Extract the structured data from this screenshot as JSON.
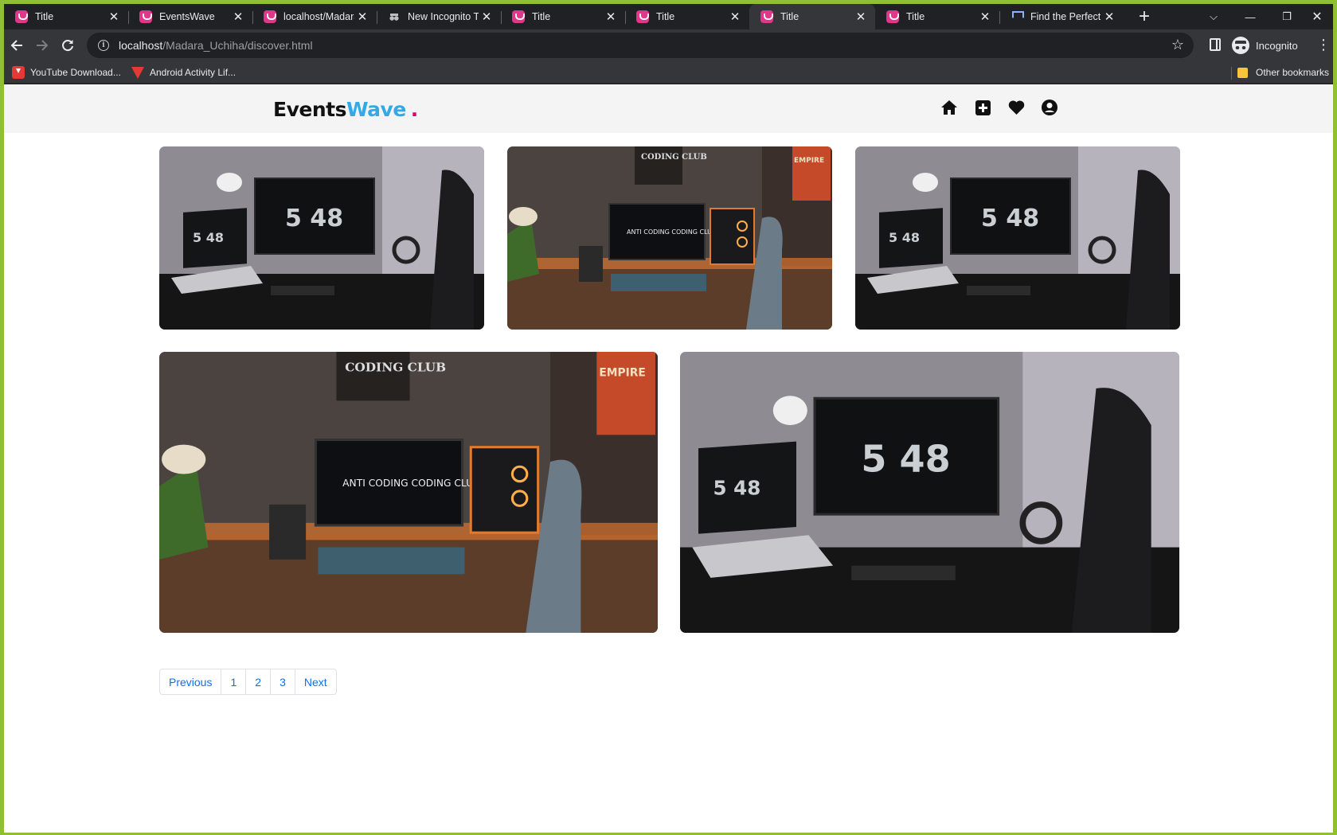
{
  "browser": {
    "tabs": [
      {
        "title": "Title",
        "icon": "eventswave-favicon-icon",
        "active": false
      },
      {
        "title": "EventsWave",
        "icon": "eventswave-favicon-icon",
        "active": false
      },
      {
        "title": "localhost/Madara",
        "icon": "eventswave-favicon-icon",
        "active": false
      },
      {
        "title": "New Incognito Ta",
        "icon": "incognito-icon",
        "active": false
      },
      {
        "title": "Title",
        "icon": "eventswave-favicon-icon",
        "active": false
      },
      {
        "title": "Title",
        "icon": "eventswave-favicon-icon",
        "active": false
      },
      {
        "title": "Title",
        "icon": "eventswave-favicon-icon",
        "active": true
      },
      {
        "title": "Title",
        "icon": "eventswave-favicon-icon",
        "active": false
      },
      {
        "title": "Find the Perfect I",
        "icon": "flag-icon",
        "active": false
      }
    ],
    "tab_close_glyph": "✕",
    "new_tab_glyph": "+",
    "window_controls": {
      "tabsearch": "⌵",
      "minimize": "—",
      "restore": "❐",
      "close": "✕"
    },
    "url_host": "localhost",
    "url_path": "/Madara_Uchiha/discover.html",
    "profile_label": "Incognito",
    "bookmarks": [
      {
        "label": "YouTube Download...",
        "icon": "youtube-downloader-icon"
      },
      {
        "label": "Android Activity Lif...",
        "icon": "vue-logo-icon"
      }
    ],
    "other_bookmarks_label": "Other bookmarks"
  },
  "site": {
    "logo": {
      "part1": "Events",
      "part2": "Wave",
      "dot": ".",
      "color_part1": "#111111",
      "color_part2": "#33a9e5",
      "color_dot": "#e0006e"
    },
    "nav": [
      {
        "name": "home-icon"
      },
      {
        "name": "add-event-icon"
      },
      {
        "name": "favorites-heart-icon"
      },
      {
        "name": "user-profile-icon"
      }
    ]
  },
  "gallery": {
    "images": [
      {
        "scene": "grey-desk-setup",
        "clock_text": "5 48"
      },
      {
        "scene": "coding-club-desk-setup",
        "poster_text": "CODING CLUB",
        "monitor_text": "ANTI CODING CODING CLUB",
        "side_poster": "EMPIRE"
      },
      {
        "scene": "grey-desk-setup",
        "clock_text": "5 48"
      },
      {
        "scene": "coding-club-desk-setup",
        "poster_text": "CODING CLUB",
        "monitor_text": "ANTI CODING CODING CLUB",
        "side_poster": "EMPIRE"
      },
      {
        "scene": "grey-desk-setup",
        "clock_text": "5 48"
      }
    ]
  },
  "pagination": {
    "previous": "Previous",
    "pages": [
      "1",
      "2",
      "3"
    ],
    "next": "Next",
    "link_color": "#0d6efd"
  }
}
